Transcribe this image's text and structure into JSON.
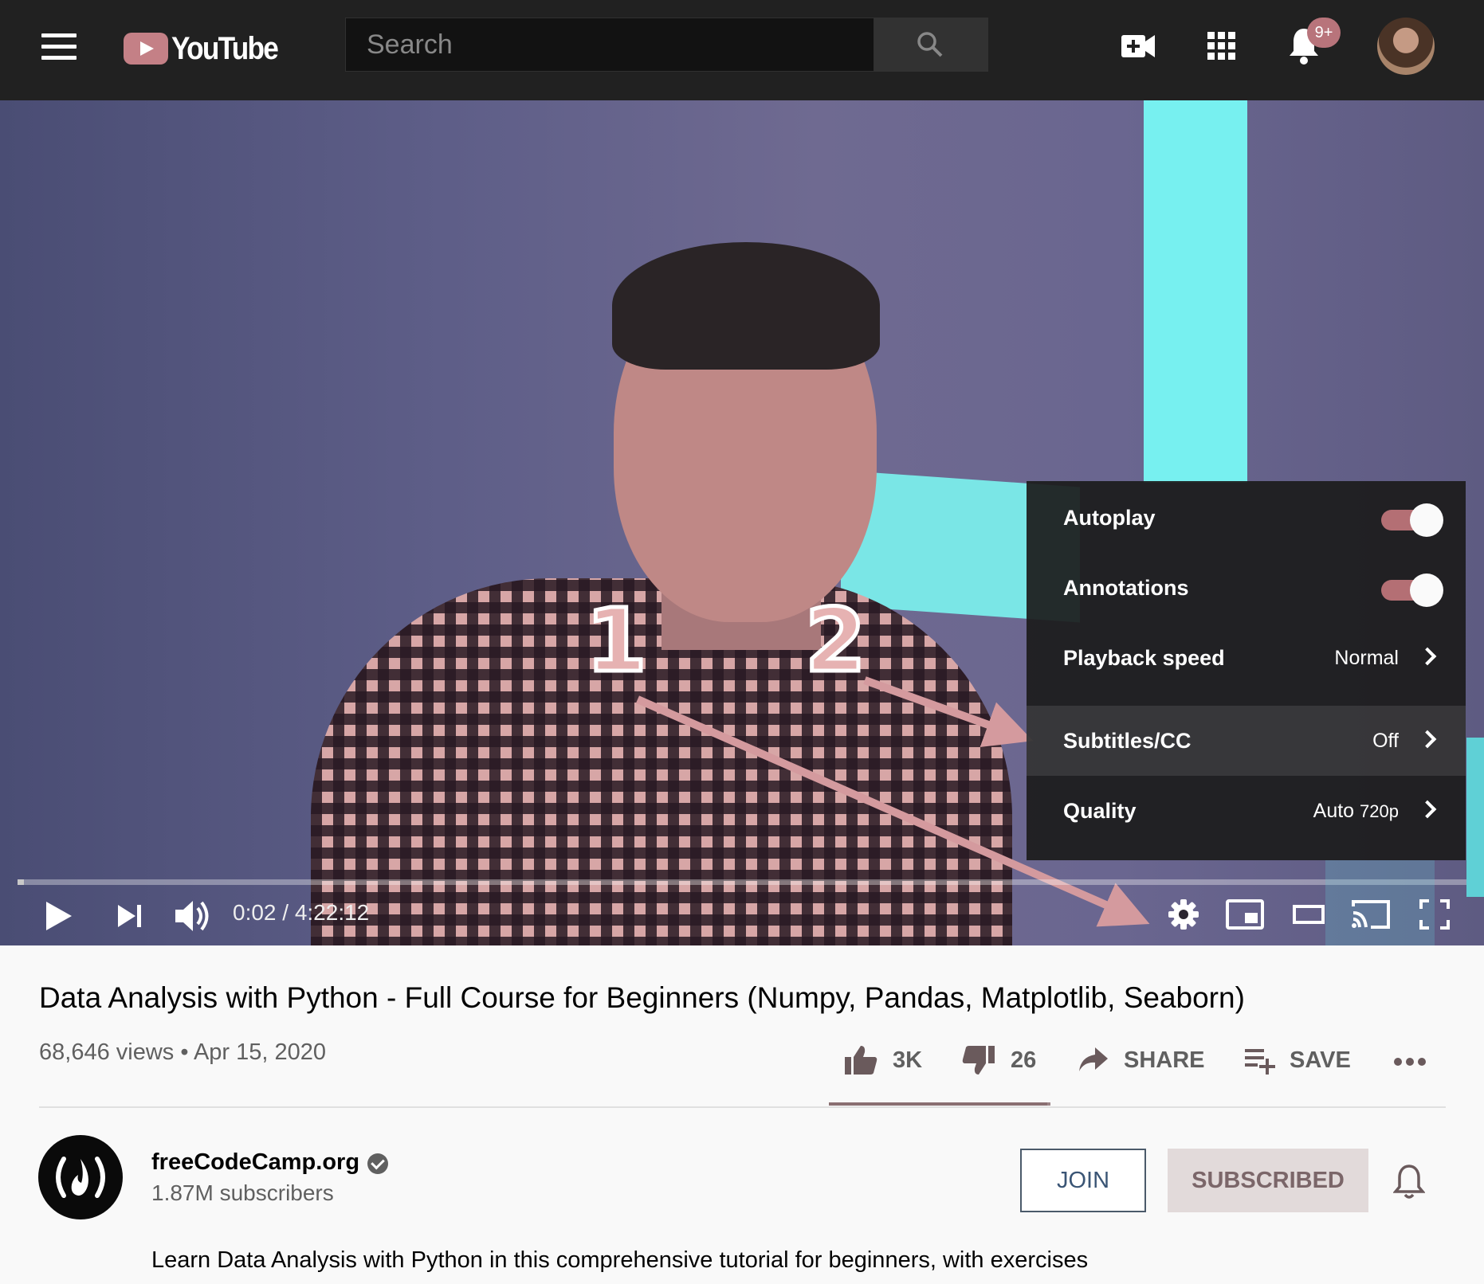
{
  "header": {
    "logo_text": "YouTube",
    "search_placeholder": "Search",
    "notification_count": "9+"
  },
  "video": {
    "annotation_1": "1",
    "annotation_2": "2",
    "current_time": "0:02",
    "duration": "4:22:12",
    "time_display": "0:02 / 4:22:12",
    "progress_fraction": 0.003
  },
  "settings": {
    "autoplay": {
      "label": "Autoplay",
      "enabled": true
    },
    "annotations": {
      "label": "Annotations",
      "enabled": true
    },
    "playback_speed": {
      "label": "Playback speed",
      "value": "Normal"
    },
    "subtitles": {
      "label": "Subtitles/CC",
      "value": "Off"
    },
    "quality": {
      "label": "Quality",
      "value": "Auto",
      "value_detail": "720p"
    }
  },
  "info": {
    "title": "Data Analysis with Python - Full Course for Beginners (Numpy, Pandas, Matplotlib, Seaborn)",
    "views_date": "68,646 views • Apr 15, 2020",
    "likes": "3K",
    "dislikes": "26",
    "share_label": "SHARE",
    "save_label": "SAVE"
  },
  "channel": {
    "name": "freeCodeCamp.org",
    "subscribers": "1.87M subscribers",
    "join_label": "JOIN",
    "subscribed_label": "SUBSCRIBED",
    "description": "Learn Data Analysis with Python in this comprehensive tutorial for beginners, with exercises"
  },
  "colors": {
    "accent": "#c48086",
    "toggle_on": "#b46f74",
    "annotation_arrow": "#d49a9e"
  }
}
